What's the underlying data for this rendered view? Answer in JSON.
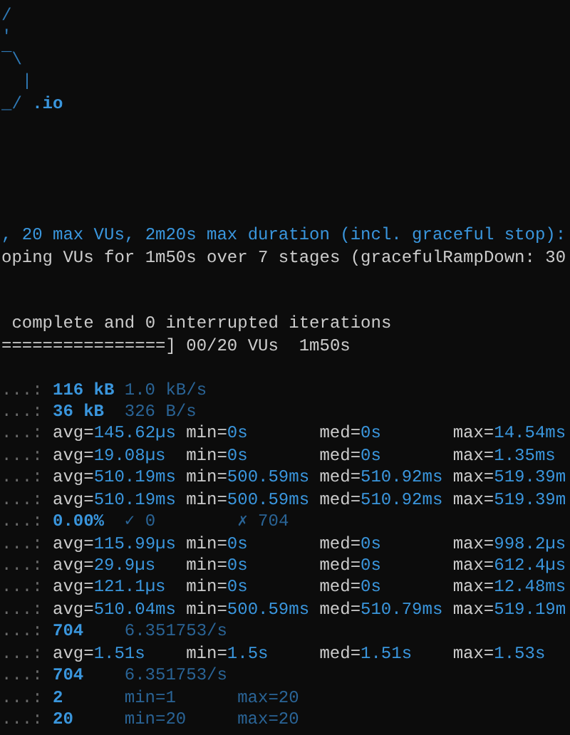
{
  "terminal": {
    "logo": {
      "lines": [
        "/",
        "'",
        "‾\\",
        "  |",
        "_/"
      ],
      "suffix": " .io"
    },
    "scenario": [
      {
        "text": ", 20 max VUs, 2m20s max duration (incl. graceful stop):",
        "kind": "highlight"
      },
      {
        "text": "oping VUs for 1m50s over 7 stages (gracefulRampDown: 30",
        "kind": "normal"
      }
    ],
    "progress": [
      " complete and 0 interrupted iterations",
      "================] 00/20 VUs  1m50s"
    ],
    "metrics": [
      {
        "kind": "counter",
        "prefix": "...:",
        "value": "116 kB",
        "extras": [
          "1.0 kB/s"
        ]
      },
      {
        "kind": "counter",
        "prefix": "...:",
        "value": "36 kB",
        "extras": [
          "326 B/s"
        ]
      },
      {
        "kind": "trend",
        "prefix": "...:",
        "cells": [
          {
            "label": "avg=",
            "value": "145.62µs"
          },
          {
            "label": "min=",
            "value": "0s"
          },
          {
            "label": "med=",
            "value": "0s"
          },
          {
            "label": "max=",
            "value": "14.54ms"
          }
        ]
      },
      {
        "kind": "trend",
        "prefix": "...:",
        "cells": [
          {
            "label": "avg=",
            "value": "19.08µs"
          },
          {
            "label": "min=",
            "value": "0s"
          },
          {
            "label": "med=",
            "value": "0s"
          },
          {
            "label": "max=",
            "value": "1.35ms"
          }
        ]
      },
      {
        "kind": "trend",
        "prefix": "...:",
        "cells": [
          {
            "label": "avg=",
            "value": "510.19ms"
          },
          {
            "label": "min=",
            "value": "500.59ms"
          },
          {
            "label": "med=",
            "value": "510.92ms"
          },
          {
            "label": "max=",
            "value": "519.39m"
          }
        ]
      },
      {
        "kind": "trend",
        "prefix": "...:",
        "cells": [
          {
            "label": "avg=",
            "value": "510.19ms"
          },
          {
            "label": "min=",
            "value": "500.59ms"
          },
          {
            "label": "med=",
            "value": "510.92ms"
          },
          {
            "label": "max=",
            "value": "519.39m"
          }
        ]
      },
      {
        "kind": "counter",
        "prefix": "...:",
        "value": "0.00%",
        "extras": [
          "✓ 0",
          "✗ 704"
        ]
      },
      {
        "kind": "trend",
        "prefix": "...:",
        "cells": [
          {
            "label": "avg=",
            "value": "115.99µs"
          },
          {
            "label": "min=",
            "value": "0s"
          },
          {
            "label": "med=",
            "value": "0s"
          },
          {
            "label": "max=",
            "value": "998.2µs"
          }
        ]
      },
      {
        "kind": "trend",
        "prefix": "...:",
        "cells": [
          {
            "label": "avg=",
            "value": "29.9µs"
          },
          {
            "label": "min=",
            "value": "0s"
          },
          {
            "label": "med=",
            "value": "0s"
          },
          {
            "label": "max=",
            "value": "612.4µs"
          }
        ]
      },
      {
        "kind": "trend",
        "prefix": "...:",
        "cells": [
          {
            "label": "avg=",
            "value": "121.1µs"
          },
          {
            "label": "min=",
            "value": "0s"
          },
          {
            "label": "med=",
            "value": "0s"
          },
          {
            "label": "max=",
            "value": "12.48ms"
          }
        ]
      },
      {
        "kind": "trend",
        "prefix": "...:",
        "cells": [
          {
            "label": "avg=",
            "value": "510.04ms"
          },
          {
            "label": "min=",
            "value": "500.59ms"
          },
          {
            "label": "med=",
            "value": "510.79ms"
          },
          {
            "label": "max=",
            "value": "519.19m"
          }
        ]
      },
      {
        "kind": "counter",
        "prefix": "...:",
        "value": "704",
        "extras": [
          "6.351753/s"
        ]
      },
      {
        "kind": "trend",
        "prefix": "...:",
        "cells": [
          {
            "label": "avg=",
            "value": "1.51s"
          },
          {
            "label": "min=",
            "value": "1.5s"
          },
          {
            "label": "med=",
            "value": "1.51s"
          },
          {
            "label": "max=",
            "value": "1.53s"
          }
        ]
      },
      {
        "kind": "counter",
        "prefix": "...:",
        "value": "704",
        "extras": [
          "6.351753/s"
        ]
      },
      {
        "kind": "counter",
        "prefix": "...:",
        "value": "2",
        "extras": [
          "min=1",
          "max=20"
        ]
      },
      {
        "kind": "counter",
        "prefix": "...:",
        "value": "20",
        "extras": [
          "min=20",
          "max=20"
        ]
      }
    ]
  }
}
